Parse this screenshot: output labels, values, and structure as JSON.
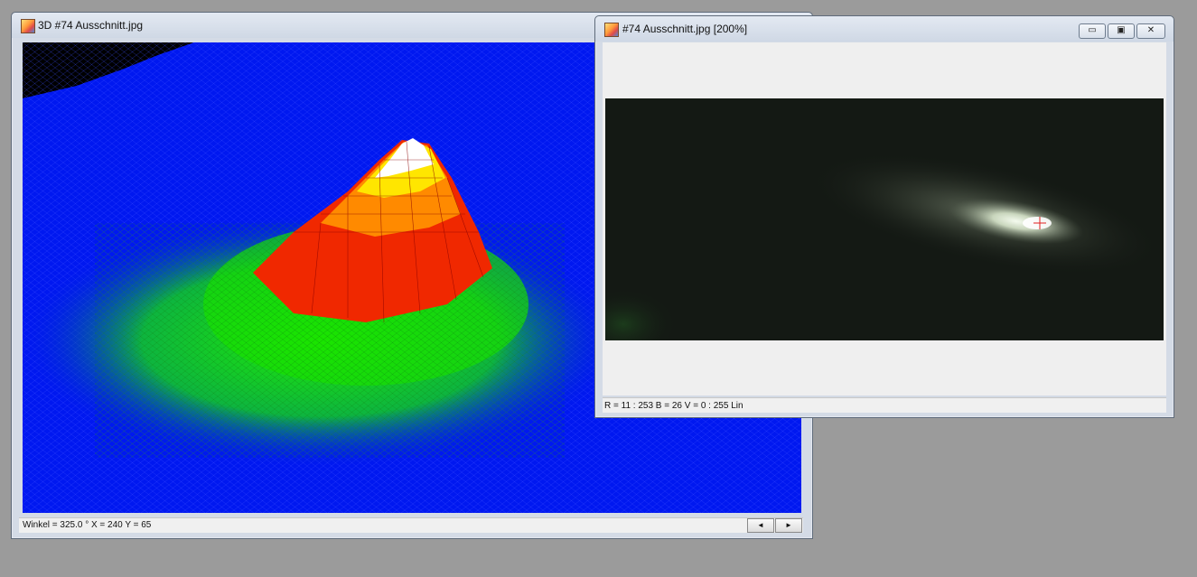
{
  "window_3d": {
    "title": "3D #74 Ausschnitt.jpg",
    "status": "Winkel = 325.0 °  X = 240  Y = 65",
    "scroll_left": "◄",
    "scroll_right": "►"
  },
  "window_image": {
    "title": "#74 Ausschnitt.jpg  [200%]",
    "status": "R = 11 : 253   B = 26   V = 0 : 255  Lin",
    "minimize": "▭",
    "maximize": "▣",
    "close": "✕"
  },
  "colors": {
    "desktop": "#9b9b9b",
    "surface_low": "#0018f0",
    "surface_mid": "#00e000",
    "surface_high": "#ff2000",
    "surface_peak": "#ffffff",
    "image_bg": "#161a16",
    "comet_core": "#e8f2e0"
  }
}
